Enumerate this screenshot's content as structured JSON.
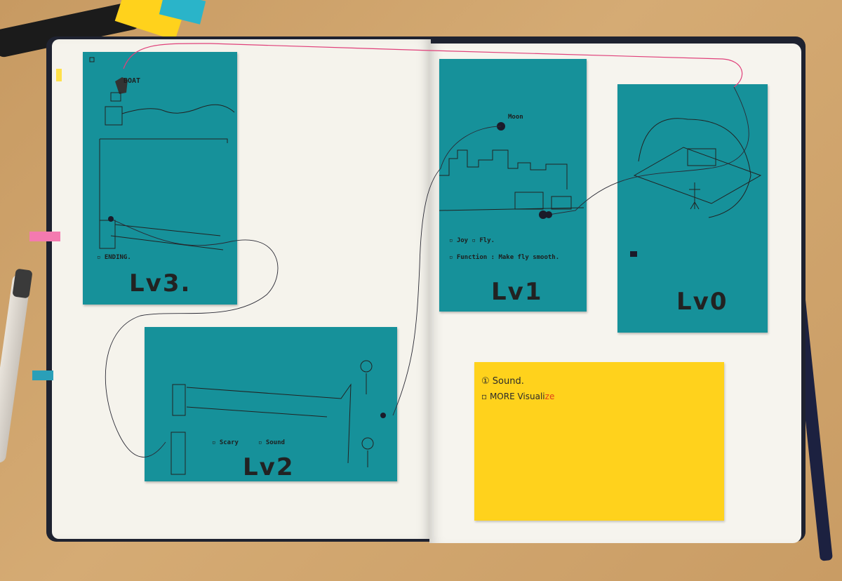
{
  "cards": {
    "lv3": {
      "label": "Lv3.",
      "boat": "BOAT",
      "ending": "▫ ENDING."
    },
    "lv2": {
      "label": "Lv2",
      "items": [
        "▫ Scary",
        "▫ Sound"
      ]
    },
    "lv1": {
      "label": "Lv1",
      "moon": "Moon",
      "items": [
        "▫ Joy  ▫ Fly.",
        "▫ Function : Make fly smooth."
      ]
    },
    "lv0": {
      "label": "Lv0"
    }
  },
  "sticky_note": {
    "line1": "① Sound.",
    "line2_prefix": "▫ MORE Visuali",
    "line2_suffix": "ze",
    "accent_color": "#e0401a"
  },
  "colors": {
    "card": "#16919a",
    "sticky": "#ffd21c",
    "paper": "#f5f3ec",
    "desk": "#c99c64",
    "thread_red": "#e0407a",
    "thread_dark": "#2a2a35"
  }
}
